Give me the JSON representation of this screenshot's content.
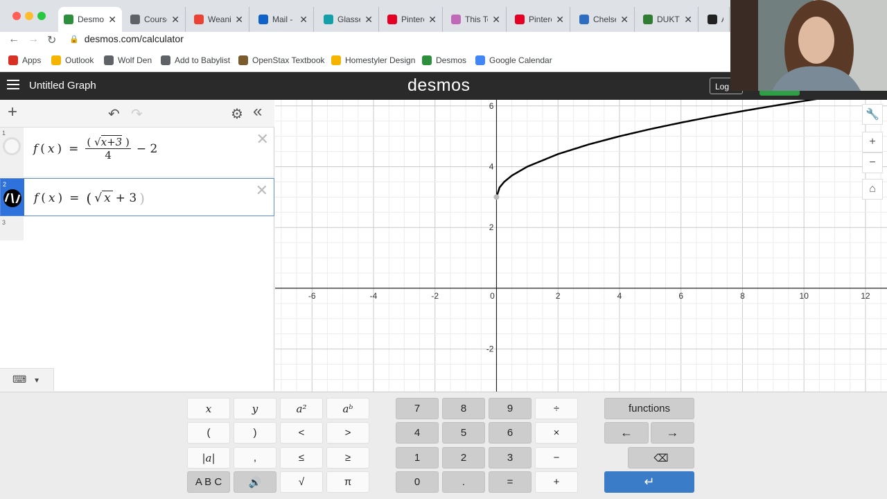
{
  "browser": {
    "tabs": [
      {
        "label": "Desmo",
        "color": "#2d8f3c"
      },
      {
        "label": "Course",
        "color": "#5f6368"
      },
      {
        "label": "Weanir",
        "color": "#ea4335"
      },
      {
        "label": "Mail - E",
        "color": "#0f62c7"
      },
      {
        "label": "Glasse",
        "color": "#14a0a8"
      },
      {
        "label": "Pintere",
        "color": "#e60023"
      },
      {
        "label": "This To",
        "color": "#c069b8"
      },
      {
        "label": "Pintere",
        "color": "#e60023"
      },
      {
        "label": "Chelse",
        "color": "#2d6cc0"
      },
      {
        "label": "DUKTI",
        "color": "#2f7d32"
      },
      {
        "label": "An",
        "color": "#222222"
      }
    ],
    "url": "desmos.com/calculator",
    "bookmarks": [
      "Apps",
      "Outlook",
      "Wolf Den",
      "Add to Babylist",
      "OpenStax Textbook",
      "Homestyler Design",
      "Desmos",
      "Google Calendar"
    ]
  },
  "header": {
    "title": "Untitled Graph",
    "logo": "desmos",
    "login": "Log"
  },
  "expressions": [
    {
      "num": "1",
      "text": "f(x) = (√x+3)/4 − 2",
      "fn": "f",
      "var": "x",
      "rad": "x+3",
      "den": "4",
      "tail": "− 2"
    },
    {
      "num": "2",
      "text": "f(x) = (√x + 3)",
      "fn": "f",
      "var": "x",
      "rad": "x",
      "plus": "+ 3"
    },
    {
      "num": "3",
      "text": ""
    }
  ],
  "graph": {
    "x_ticks": [
      "-6",
      "-4",
      "-2",
      "0",
      "2",
      "4",
      "6",
      "8",
      "10",
      "12"
    ],
    "y_ticks": [
      "6",
      "4",
      "2",
      "-2"
    ]
  },
  "chart_data": {
    "type": "line",
    "title": "",
    "xlabel": "",
    "ylabel": "",
    "xlim": [
      -7.2,
      12.7
    ],
    "ylim": [
      -3.4,
      6.2
    ],
    "grid": true,
    "series": [
      {
        "x": [
          0,
          0.1,
          0.25,
          0.5,
          1,
          2,
          3,
          4,
          5,
          6,
          7,
          8,
          9,
          10,
          11
        ],
        "y": [
          3,
          3.316,
          3.5,
          3.707,
          4,
          4.414,
          4.732,
          5,
          5.236,
          5.449,
          5.646,
          5.828,
          6,
          6.162,
          6.317
        ]
      }
    ],
    "points": [
      {
        "x": 0,
        "y": 3
      }
    ]
  },
  "keypad": {
    "left": [
      [
        "x",
        "y",
        "a²",
        "aᵇ"
      ],
      [
        "(",
        ")",
        "<",
        ">"
      ],
      [
        "|a|",
        ",",
        "≤",
        "≥"
      ],
      [
        "A B C",
        "🔊",
        "√",
        "π"
      ]
    ],
    "mid": [
      [
        "7",
        "8",
        "9",
        "÷"
      ],
      [
        "4",
        "5",
        "6",
        "×"
      ],
      [
        "1",
        "2",
        "3",
        "−"
      ],
      [
        "0",
        ".",
        "=",
        "+"
      ]
    ],
    "right": {
      "functions": "functions",
      "left": "←",
      "right": "→",
      "backspace": "⌫",
      "enter": "↵"
    }
  }
}
